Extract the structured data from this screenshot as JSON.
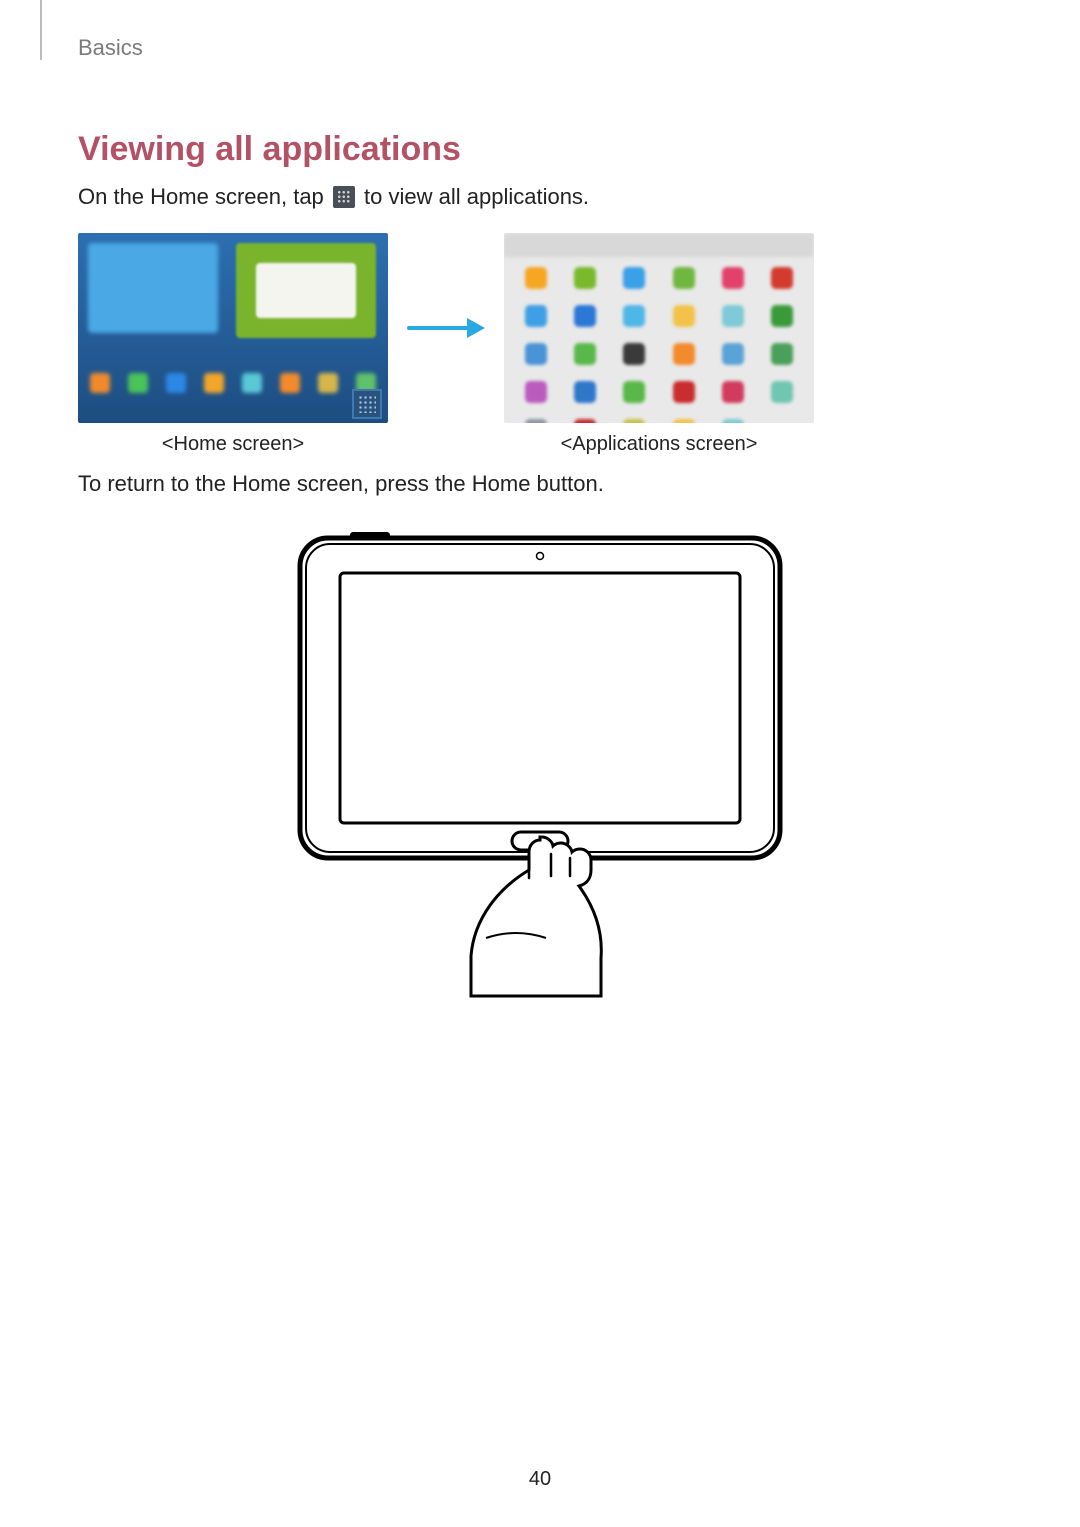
{
  "header": {
    "section": "Basics"
  },
  "title": "Viewing all applications",
  "body": {
    "intro_before": "On the Home screen, tap ",
    "intro_after": " to view all applications.",
    "return_line": "To return to the Home screen, press the Home button."
  },
  "captions": {
    "home": "<Home screen>",
    "apps": "<Applications screen>"
  },
  "icons": {
    "apps_grid": "apps-grid-icon",
    "arrow": "arrow-right-icon"
  },
  "page_number": "40",
  "app_colors": [
    "#f5a623",
    "#7ab82d",
    "#3aa0e8",
    "#6fb83f",
    "#e2416b",
    "#d23b2d",
    "#3f9fe6",
    "#2b78d6",
    "#4fb6e8",
    "#f3c24a",
    "#7fcad6",
    "#3a9a3a",
    "#4a93d6",
    "#59b84a",
    "#3a3a3a",
    "#f38b2d",
    "#5aa3d6",
    "#4aa05a",
    "#b95bbf",
    "#2e78c9",
    "#59b84a",
    "#c92d2d",
    "#d23b5d",
    "#6fc6b1",
    "#8c97a6",
    "#c92d2d",
    "#c9c14a",
    "#f3c24a",
    "#7fcad6"
  ]
}
